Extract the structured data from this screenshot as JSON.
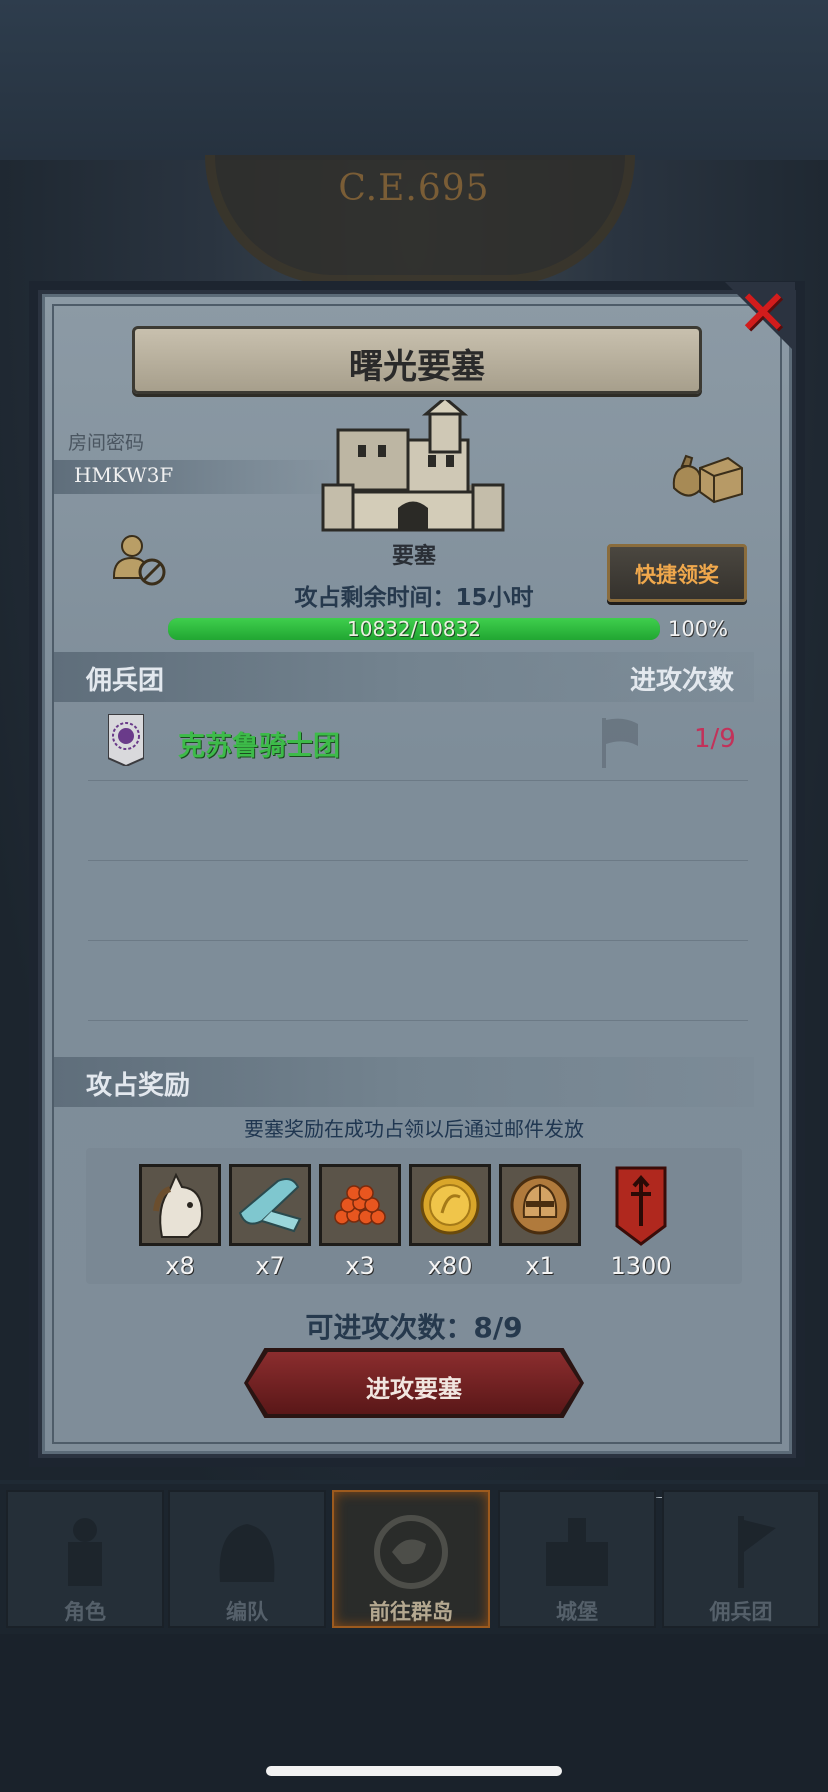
{
  "background": {
    "era": "C.E.695"
  },
  "dialog": {
    "title": "曙光要塞",
    "room": {
      "label": "房间密码",
      "code": "HMKW3F"
    },
    "fortress_label": "要塞",
    "quick_claim_label": "快捷领奖",
    "time_remaining": "攻占剩余时间：15小时",
    "progress": {
      "text": "10832/10832",
      "percent_text": "100%",
      "fraction": 1.0
    },
    "mercenary_section": {
      "title": "佣兵团",
      "column_attacks": "进攻次数",
      "rows": [
        {
          "name": "克苏鲁骑士团",
          "attacks": "1/9"
        }
      ]
    },
    "reward_section": {
      "title": "攻占奖励",
      "note": "要塞奖励在成功占领以后通过邮件发放",
      "items": [
        {
          "icon": "horse-icon",
          "count": "x8"
        },
        {
          "icon": "cloth-roll-icon",
          "count": "x7"
        },
        {
          "icon": "orange-berries-icon",
          "count": "x3"
        },
        {
          "icon": "gold-coin-icon",
          "count": "x80"
        },
        {
          "icon": "knight-helmet-icon",
          "count": "x1"
        },
        {
          "icon": "red-banner-icon",
          "count": "1300"
        }
      ]
    },
    "attacks_left": "可进攻次数：8/9",
    "attack_button": "进攻要塞"
  },
  "nav": {
    "items": [
      {
        "label": "角色",
        "active": false
      },
      {
        "label": "编队",
        "active": false
      },
      {
        "label": "前往群岛",
        "active": true
      },
      {
        "label": "城堡",
        "active": false
      },
      {
        "label": "佣兵团",
        "active": false
      }
    ]
  },
  "colors": {
    "guild_name": "#3dbb49",
    "attack_count": "#c2325a",
    "progress": "#2fbf40",
    "close": "#d21c1c",
    "quick_claim_text": "#f0a84c"
  }
}
